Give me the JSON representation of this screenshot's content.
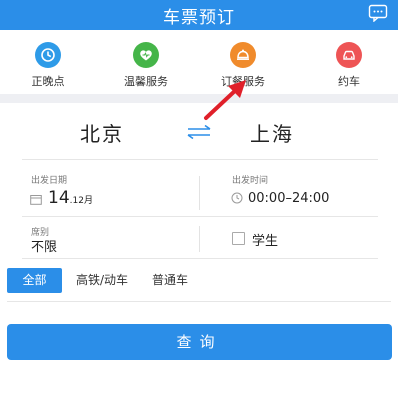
{
  "header": {
    "title": "车票预订"
  },
  "quick_actions": [
    {
      "label": "正晚点",
      "icon": "clock-icon",
      "color": "#2e9be8"
    },
    {
      "label": "温馨服务",
      "icon": "heart-icon",
      "color": "#45b549"
    },
    {
      "label": "订餐服务",
      "icon": "meal-icon",
      "color": "#f08b2c"
    },
    {
      "label": "约车",
      "icon": "car-icon",
      "color": "#ee5455"
    }
  ],
  "route": {
    "from": "北京",
    "to": "上海"
  },
  "depart_date": {
    "label": "出发日期",
    "day": "14",
    "month": ".12月"
  },
  "depart_time": {
    "label": "出发时间",
    "value": "00:00–24:00"
  },
  "seat": {
    "label": "席别",
    "value": "不限"
  },
  "student": {
    "label": "学生"
  },
  "train_tabs": [
    "全部",
    "高铁/动车",
    "普通车"
  ],
  "query_button": "查询",
  "colors": {
    "primary": "#2b8ee8",
    "annotation_arrow": "#e0202a"
  }
}
